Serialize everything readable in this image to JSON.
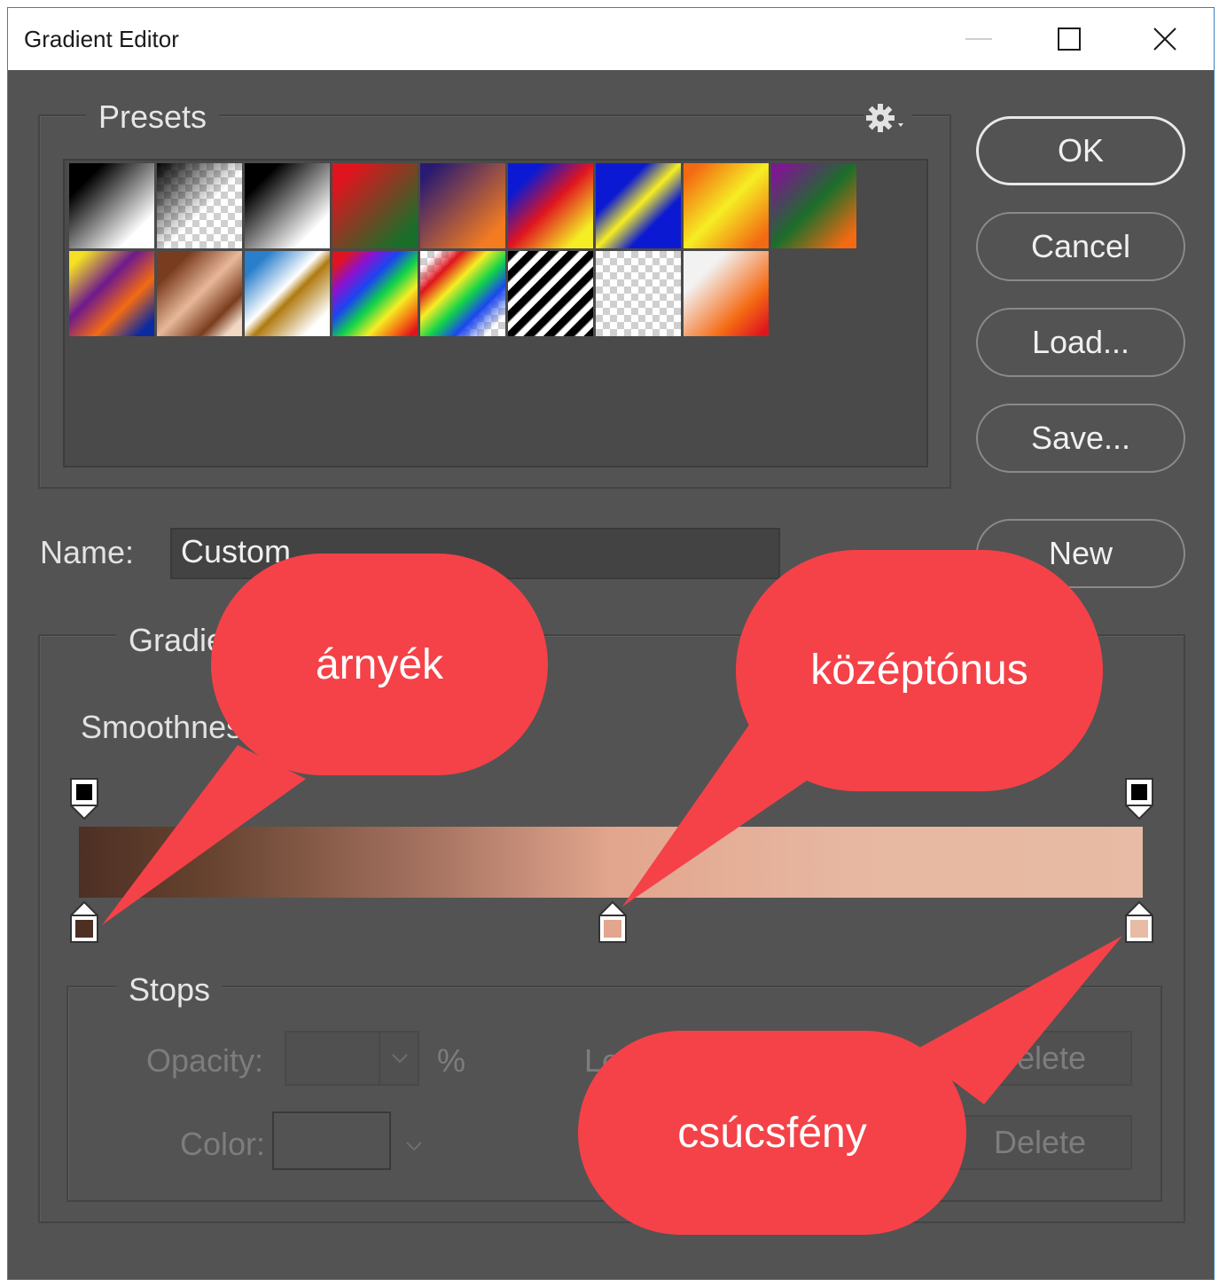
{
  "window": {
    "title": "Gradient Editor"
  },
  "presets": {
    "label": "Presets"
  },
  "buttons": {
    "ok": "OK",
    "cancel": "Cancel",
    "load": "Load...",
    "save": "Save...",
    "new": "New"
  },
  "name": {
    "label": "Name:",
    "value": "Custom"
  },
  "gradient_type": {
    "label": "Gradie"
  },
  "smoothness": {
    "label": "Smoothnes"
  },
  "stops": {
    "label": "Stops",
    "opacity_label": "Opacity:",
    "opacity_unit": "%",
    "location_label_partial": "Lo",
    "delete_top": "Delete",
    "color_label": "Color:",
    "delete_bottom": "Delete"
  },
  "callouts": {
    "shadow": "árnyék",
    "midtone": "középtónus",
    "highlight": "csúcsfény"
  },
  "colors": {
    "callout": "#f44248",
    "stop_dark": "#4d2f24",
    "stop_mid": "#e2a58d",
    "stop_light": "#e7bba5"
  }
}
